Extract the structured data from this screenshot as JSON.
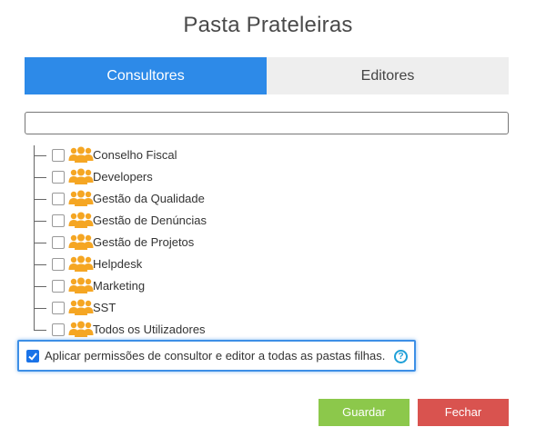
{
  "dialog": {
    "title": "Pasta Prateleiras"
  },
  "tabs": [
    {
      "label": "Consultores",
      "active": true
    },
    {
      "label": "Editores",
      "active": false
    }
  ],
  "search": {
    "value": "",
    "placeholder": ""
  },
  "tree": {
    "icon": "group-users-icon",
    "icon_color": "#f5a623",
    "items": [
      {
        "label": "Conselho Fiscal",
        "checked": false
      },
      {
        "label": "Developers",
        "checked": false
      },
      {
        "label": "Gestão da Qualidade",
        "checked": false
      },
      {
        "label": "Gestão de Denúncias",
        "checked": false
      },
      {
        "label": "Gestão de Projetos",
        "checked": false
      },
      {
        "label": "Helpdesk",
        "checked": false
      },
      {
        "label": "Marketing",
        "checked": false
      },
      {
        "label": "SST",
        "checked": false
      },
      {
        "label": "Todos os Utilizadores",
        "checked": false
      }
    ]
  },
  "apply_children": {
    "label": "Aplicar permissões de consultor e editor a todas as pastas filhas.",
    "checked": true,
    "help_icon": "?"
  },
  "buttons": {
    "save_label": "Guardar",
    "close_label": "Fechar"
  },
  "colors": {
    "accent": "#2d8ae8",
    "save": "#8cc84b",
    "close": "#d9534f"
  }
}
